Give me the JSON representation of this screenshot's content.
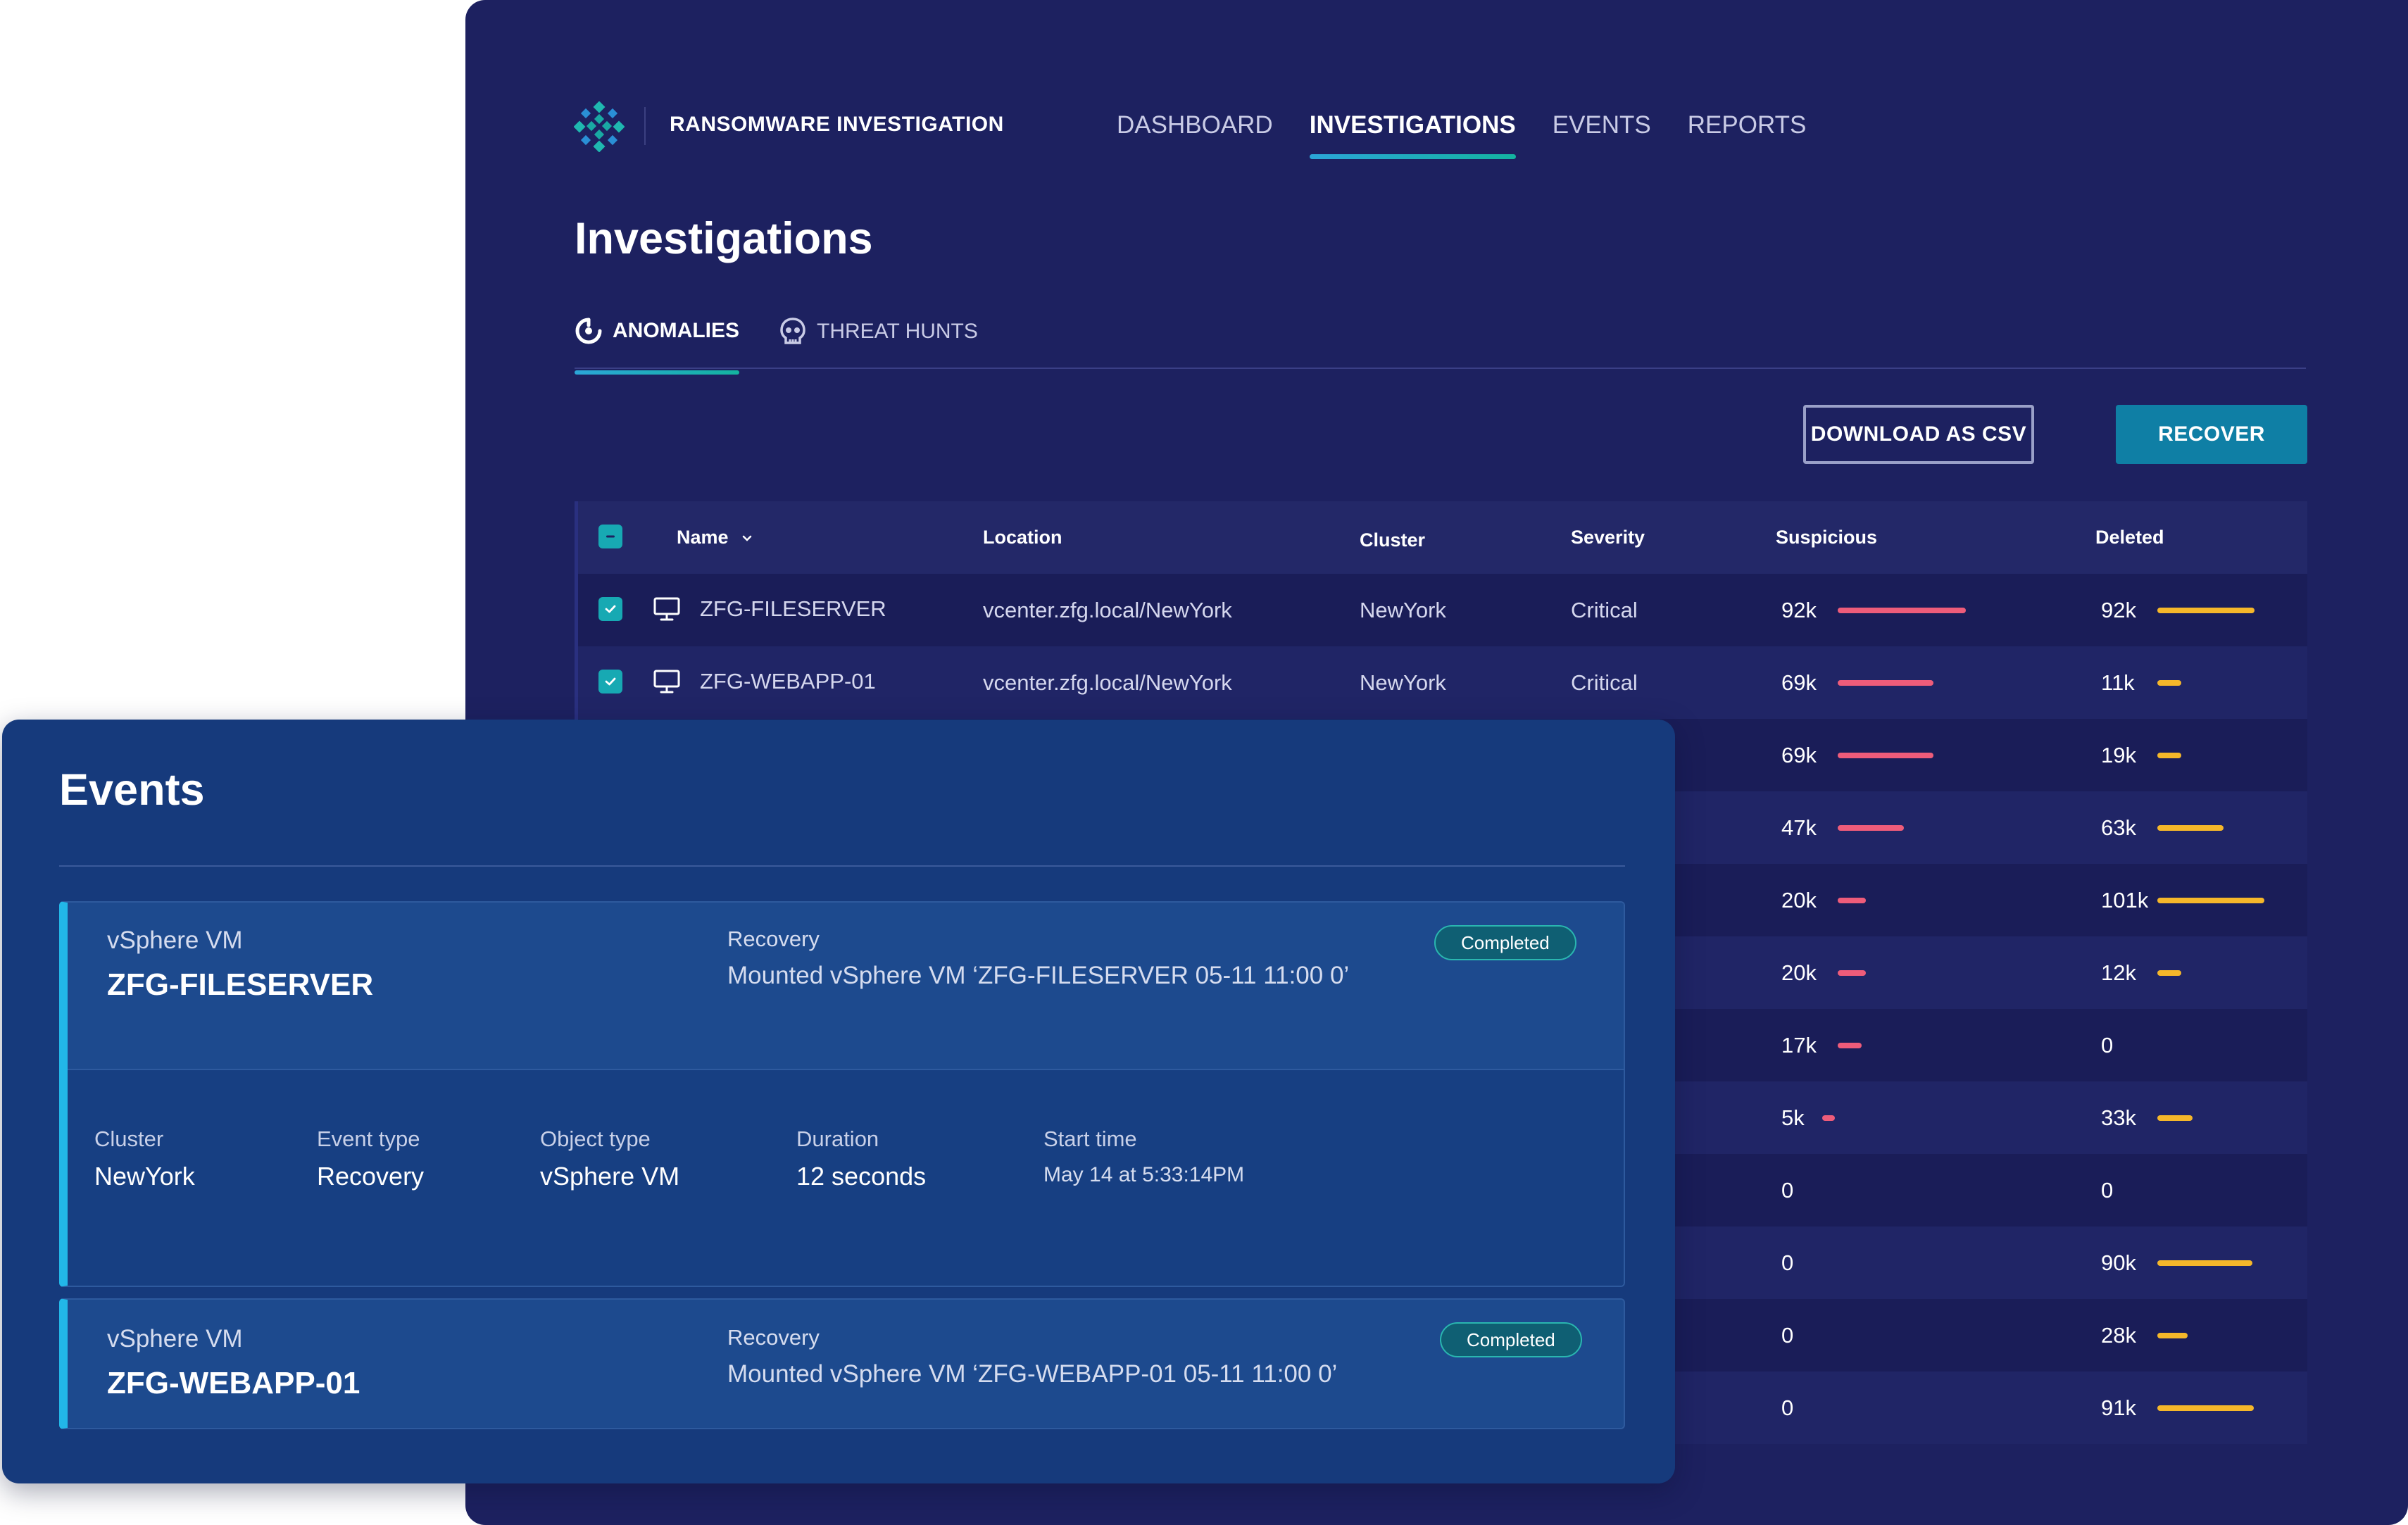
{
  "app": {
    "title": "RANSOMWARE INVESTIGATION"
  },
  "nav": {
    "items": [
      "DASHBOARD",
      "INVESTIGATIONS",
      "EVENTS",
      "REPORTS"
    ],
    "active": "INVESTIGATIONS"
  },
  "page": {
    "title": "Investigations"
  },
  "subtabs": {
    "anomalies": "ANOMALIES",
    "threat_hunts": "THREAT HUNTS"
  },
  "actions": {
    "download_csv": "DOWNLOAD AS CSV",
    "recover": "RECOVER"
  },
  "table": {
    "headers": {
      "name": "Name",
      "location": "Location",
      "cluster": "Cluster",
      "severity": "Severity",
      "suspicious": "Suspicious",
      "deleted": "Deleted"
    },
    "rows": [
      {
        "name": "ZFG-FILESERVER",
        "location": "vcenter.zfg.local/NewYork",
        "cluster": "NewYork",
        "severity": "Critical",
        "suspicious": "92k",
        "suspicious_frac": 0.91,
        "deleted": "92k",
        "deleted_frac": 0.91
      },
      {
        "name": "ZFG-WEBAPP-01",
        "location": "vcenter.zfg.local/NewYork",
        "cluster": "NewYork",
        "severity": "Critical",
        "suspicious": "69k",
        "suspicious_frac": 0.68,
        "deleted": "11k",
        "deleted_frac": 0.11
      },
      {
        "suspicious": "69k",
        "suspicious_frac": 0.68,
        "deleted": "19k",
        "deleted_frac": 0.19
      },
      {
        "suspicious": "47k",
        "suspicious_frac": 0.47,
        "deleted": "63k",
        "deleted_frac": 0.62
      },
      {
        "suspicious": "20k",
        "suspicious_frac": 0.2,
        "deleted": "101k",
        "deleted_frac": 1.0
      },
      {
        "suspicious": "20k",
        "suspicious_frac": 0.2,
        "deleted": "12k",
        "deleted_frac": 0.12
      },
      {
        "suspicious": "17k",
        "suspicious_frac": 0.17,
        "deleted": "0",
        "deleted_frac": 0
      },
      {
        "suspicious": "5k",
        "suspicious_frac": 0.05,
        "deleted": "33k",
        "deleted_frac": 0.33
      },
      {
        "suspicious": "0",
        "suspicious_frac": 0,
        "deleted": "0",
        "deleted_frac": 0
      },
      {
        "suspicious": "0",
        "suspicious_frac": 0,
        "deleted": "90k",
        "deleted_frac": 0.89
      },
      {
        "suspicious": "0",
        "suspicious_frac": 0,
        "deleted": "28k",
        "deleted_frac": 0.28
      },
      {
        "suspicious": "0",
        "suspicious_frac": 0,
        "deleted": "91k",
        "deleted_frac": 0.9
      }
    ]
  },
  "events": {
    "title": "Events",
    "cards": [
      {
        "object_type": "vSphere VM",
        "object_name": "ZFG-FILESERVER",
        "event_kind": "Recovery",
        "message": "Mounted vSphere VM ‘ZFG-FILESERVER 05-11 11:00 0’",
        "status": "Completed",
        "details": {
          "cluster_label": "Cluster",
          "cluster": "NewYork",
          "event_type_label": "Event type",
          "event_type": "Recovery",
          "object_type_label": "Object type",
          "object_type": "vSphere VM",
          "duration_label": "Duration",
          "duration": "12 seconds",
          "start_time_label": "Start time",
          "start_time": "May 14 at 5:33:14PM"
        }
      },
      {
        "object_type": "vSphere VM",
        "object_name": "ZFG-WEBAPP-01",
        "event_kind": "Recovery",
        "message": "Mounted vSphere VM ‘ZFG-WEBAPP-01 05-11 11:00 0’",
        "status": "Completed"
      }
    ]
  },
  "colors": {
    "panel_bg": "#1d2160",
    "events_bg": "#163a7c",
    "accent_teal": "#17a9b3",
    "suspicious_bar": "#ee5c7a",
    "deleted_bar": "#f5b72a",
    "primary_button": "#0f7fa5"
  }
}
